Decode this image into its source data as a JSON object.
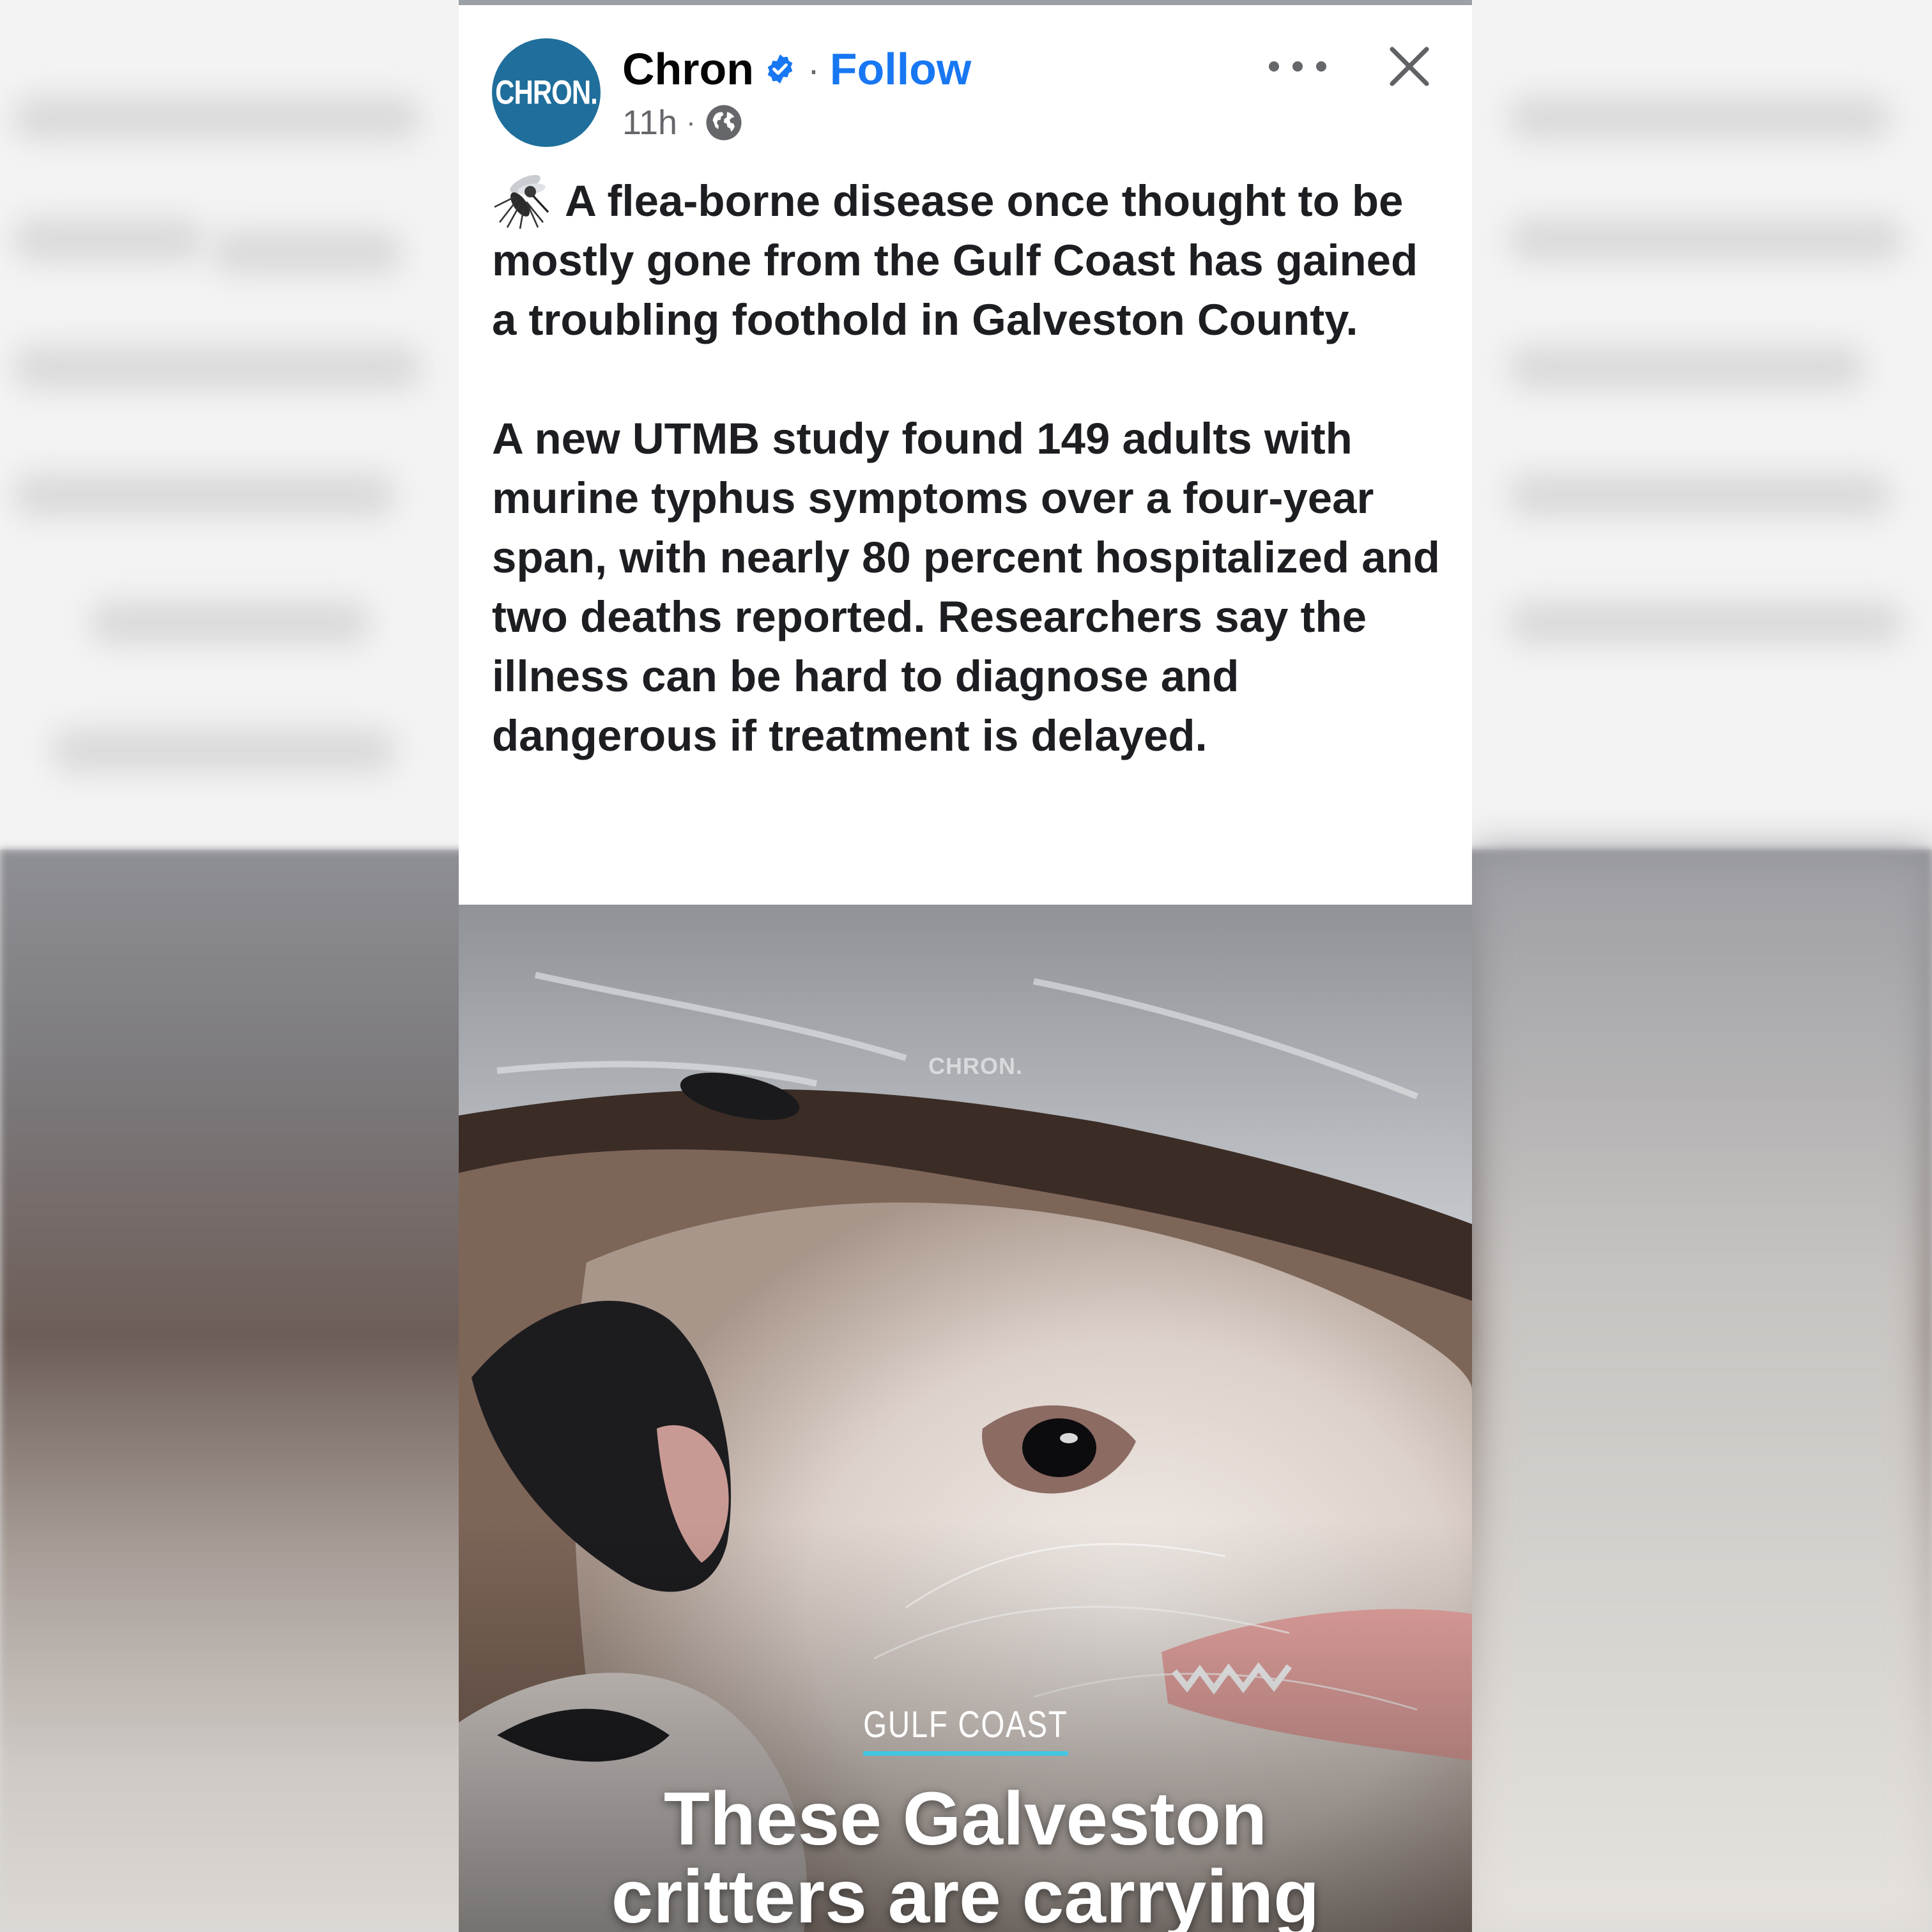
{
  "post": {
    "page_name": "Chron",
    "avatar_text": "CHRON.",
    "separator": "·",
    "follow_label": "Follow",
    "time": "11h",
    "meta_separator": "·",
    "paragraph_1": "A flea-borne disease once thought to be mostly gone from the Gulf Coast has gained a troubling foothold in Galveston County.",
    "paragraph_2": "A new UTMB study found 149 adults with murine typhus symptoms over a four-year span, with nearly 80 percent hospitalized and two deaths reported. Researchers say the illness can be hard to diagnose and dangerous if treatment is delayed.",
    "lead_emoji_icon": "mosquito-icon",
    "privacy_icon": "globe-icon"
  },
  "image": {
    "watermark": "CHRON.",
    "kicker": "GULF COAST",
    "headline_line_1": "These Galveston",
    "headline_line_2": "critters are carrying"
  },
  "colors": {
    "accent": "#1877f2",
    "avatar_bg": "#1f6e9b",
    "kicker_underline": "#3fc7e3"
  }
}
